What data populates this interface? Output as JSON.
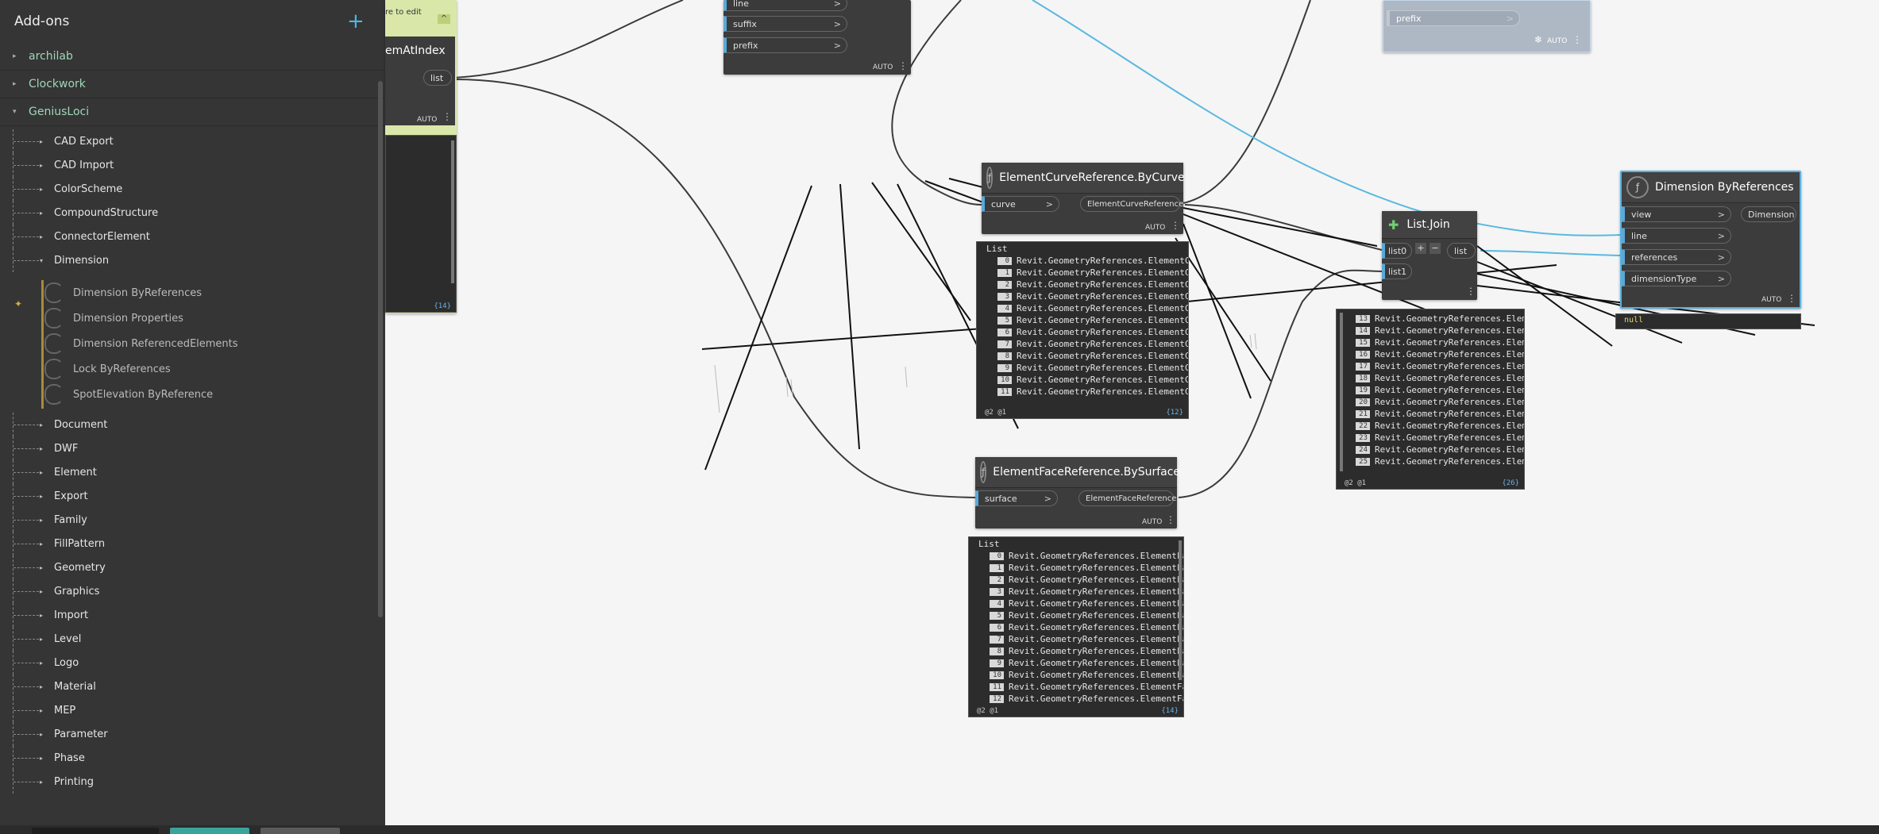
{
  "library": {
    "title": "Add-ons",
    "add_icon": "plus-icon",
    "packages": [
      "archilab",
      "Clockwork",
      "GeniusLoci"
    ],
    "categories_before": [
      "CAD Export",
      "CAD Import",
      "ColorScheme",
      "CompoundStructure",
      "ConnectorElement",
      "Dimension"
    ],
    "dimension_members": [
      "Dimension ByReferences",
      "Dimension Properties",
      "Dimension ReferencedElements",
      "Lock ByReferences",
      "SpotElevation ByReference"
    ],
    "categories_after": [
      "Document",
      "DWF",
      "Element",
      "Export",
      "Family",
      "FillPattern",
      "Geometry",
      "Graphics",
      "Import",
      "Level",
      "Logo",
      "Material",
      "MEP",
      "Parameter",
      "Phase",
      "Printing"
    ]
  },
  "nodes": {
    "item_at_index": {
      "title": "emAtIndex",
      "note": "re to edit",
      "out_port": "list",
      "lacing": "AUTO",
      "count": "{14}"
    },
    "string_node": {
      "ports": [
        "line",
        "suffix",
        "prefix"
      ],
      "lacing": "AUTO"
    },
    "frozen_node": {
      "port": "prefix",
      "lacing": "AUTO"
    },
    "curve_ref": {
      "title": "ElementCurveReference.ByCurve",
      "in_port": "curve",
      "out_port": "ElementCurveReference",
      "lacing": "AUTO",
      "preview_header": "List",
      "preview_item": "Revit.GeometryReferences.ElementCurve",
      "indices": [
        "0",
        "1",
        "2",
        "3",
        "4",
        "5",
        "6",
        "7",
        "8",
        "9",
        "10",
        "11"
      ],
      "levels": "@2 @1",
      "count": "{12}"
    },
    "face_ref": {
      "title": "ElementFaceReference.BySurface",
      "in_port": "surface",
      "out_port": "ElementFaceReference",
      "lacing": "AUTO",
      "preview_header": "List",
      "preview_item": "Revit.GeometryReferences.ElementFaceRe",
      "indices": [
        "0",
        "1",
        "2",
        "3",
        "4",
        "5",
        "6",
        "7",
        "8",
        "9",
        "10",
        "11",
        "12"
      ],
      "levels": "@2 @1",
      "count": "{14}"
    },
    "list_join": {
      "title": "List.Join",
      "in_ports": [
        "list0",
        "list1"
      ],
      "out_port": "list",
      "preview_item": "Revit.GeometryReferences.Eleme",
      "indices": [
        "13",
        "14",
        "15",
        "16",
        "17",
        "18",
        "19",
        "20",
        "21",
        "22",
        "23",
        "24",
        "25"
      ],
      "levels": "@2 @1",
      "count": "{26}"
    },
    "dim_by_refs": {
      "title": "Dimension ByReferences",
      "in_ports": [
        "view",
        "line",
        "references",
        "dimensionType"
      ],
      "out_port": "Dimension",
      "lacing": "AUTO",
      "preview": "null"
    }
  },
  "colors": {
    "accent": "#5aa8d8",
    "package_green": "#9fd6b9",
    "highlight_node": "#d9e8a8",
    "dim_border": "#5ab0e0"
  }
}
